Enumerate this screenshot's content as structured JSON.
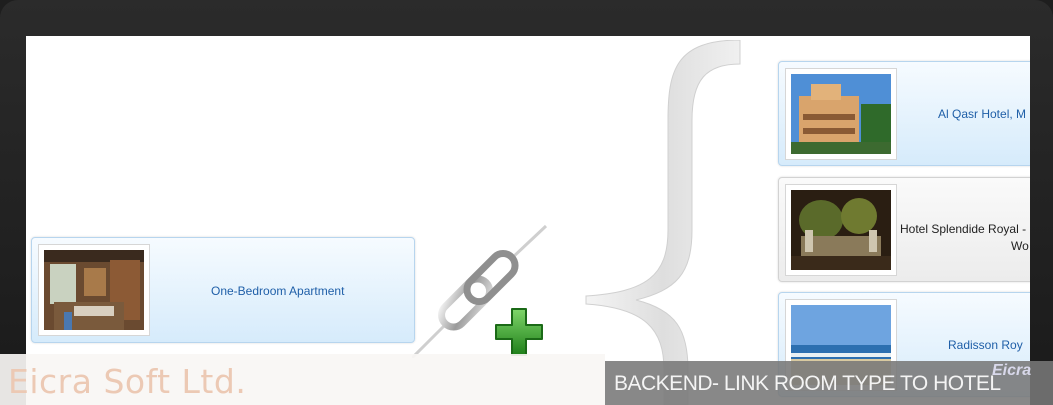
{
  "room_type": {
    "label": "One-Bedroom Apartment"
  },
  "hotels": [
    {
      "label": "Al Qasr Hotel, M"
    },
    {
      "label_line1": "Hotel Splendide Royal -",
      "label_line2": "Wo"
    },
    {
      "label": "Radisson Roy"
    }
  ],
  "footer": {
    "brand": "Eicra Soft Ltd.",
    "caption": "BACKEND- LINK ROOM TYPE TO HOTEL",
    "logo": "Eicra"
  },
  "icons": [
    "chain-link-icon",
    "plus-icon",
    "curly-brace"
  ],
  "colors": {
    "accent": "#1f5fa8",
    "plus": "#2f9a2c",
    "card": "#d6ebfb"
  }
}
